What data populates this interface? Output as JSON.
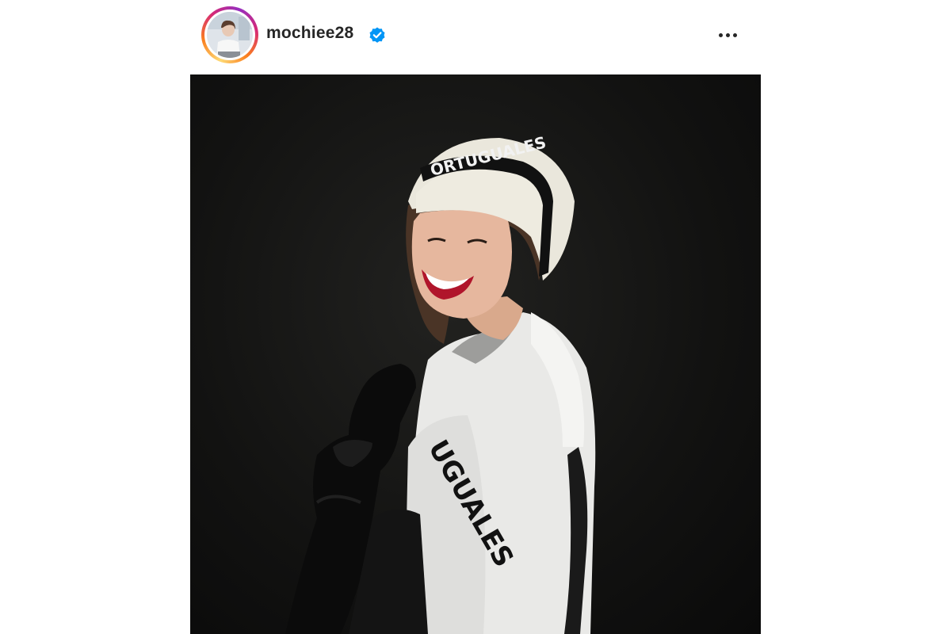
{
  "post": {
    "username": "mochiee28",
    "verified": true,
    "more_options_icon": "more-horizontal-icon",
    "avatar_icon": "profile-avatar",
    "image_semantic": "photo",
    "beanie_text": "ORTUGUALES",
    "hoodie_text": "UGUALES"
  },
  "colors": {
    "background": "#ffffff",
    "username": "#262626",
    "verified_badge": "#0095f6",
    "photo_backdrop": "#121211"
  }
}
